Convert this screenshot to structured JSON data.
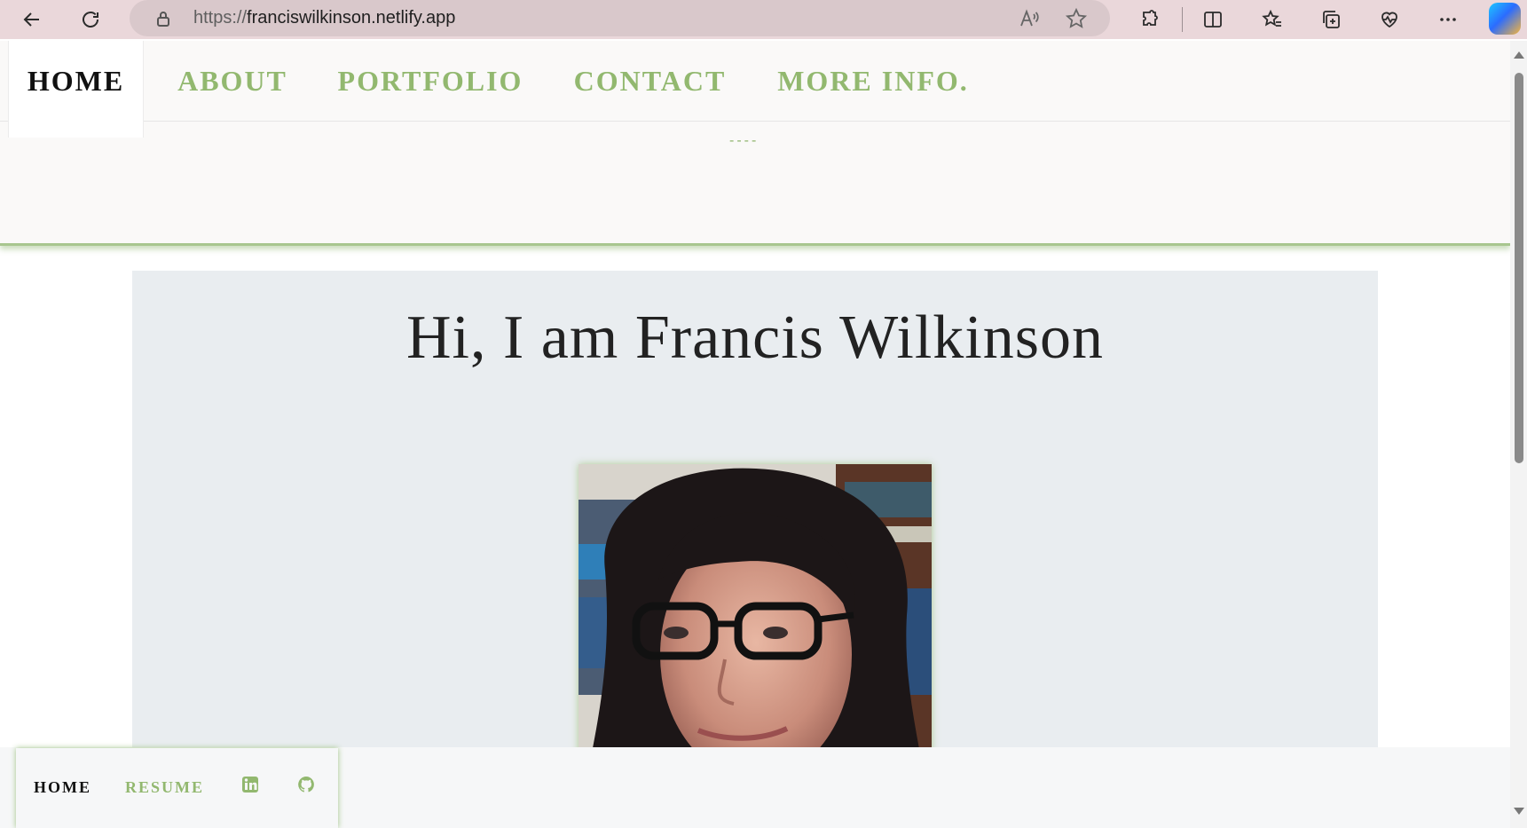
{
  "browser": {
    "url_scheme": "https://",
    "url_host": "franciswilkinson.netlify.app",
    "icons": [
      "back-icon",
      "refresh-icon",
      "lock-icon",
      "read-aloud-icon",
      "favorite-star-icon",
      "extensions-icon",
      "split-screen-icon",
      "favorites-icon",
      "collections-icon",
      "browser-essentials-icon",
      "more-icon",
      "copilot-icon"
    ]
  },
  "header": {
    "nav": [
      {
        "label": "HOME"
      },
      {
        "label": "ABOUT"
      },
      {
        "label": "PORTFOLIO"
      },
      {
        "label": "CONTACT"
      },
      {
        "label": "MORE INFO."
      }
    ],
    "dashes": "----"
  },
  "hero": {
    "title": "Hi, I am Francis Wilkinson"
  },
  "footer_nav": {
    "home": "HOME",
    "resume": "RESUME",
    "icons": [
      "linkedin-icon",
      "github-icon"
    ]
  },
  "colors": {
    "accent_green": "#92b86f",
    "hero_bg": "#e9edf0",
    "browser_bar": "#ead7da"
  }
}
